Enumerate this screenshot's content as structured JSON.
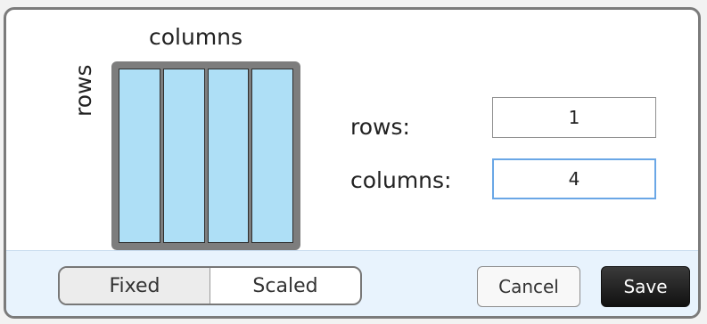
{
  "preview": {
    "columns_label": "columns",
    "rows_label": "rows",
    "column_count": 4
  },
  "fields": {
    "rows_label": "rows:",
    "rows_value": "1",
    "columns_label": "columns:",
    "columns_value": "4"
  },
  "footer": {
    "toggle_fixed": "Fixed",
    "toggle_scaled": "Scaled",
    "cancel_label": "Cancel",
    "save_label": "Save"
  },
  "colors": {
    "preview_frame": "#7d7d7d",
    "preview_cell": "#aedff6",
    "footer_bg": "#e8f3fd",
    "focus_border": "#6aa7e6"
  }
}
